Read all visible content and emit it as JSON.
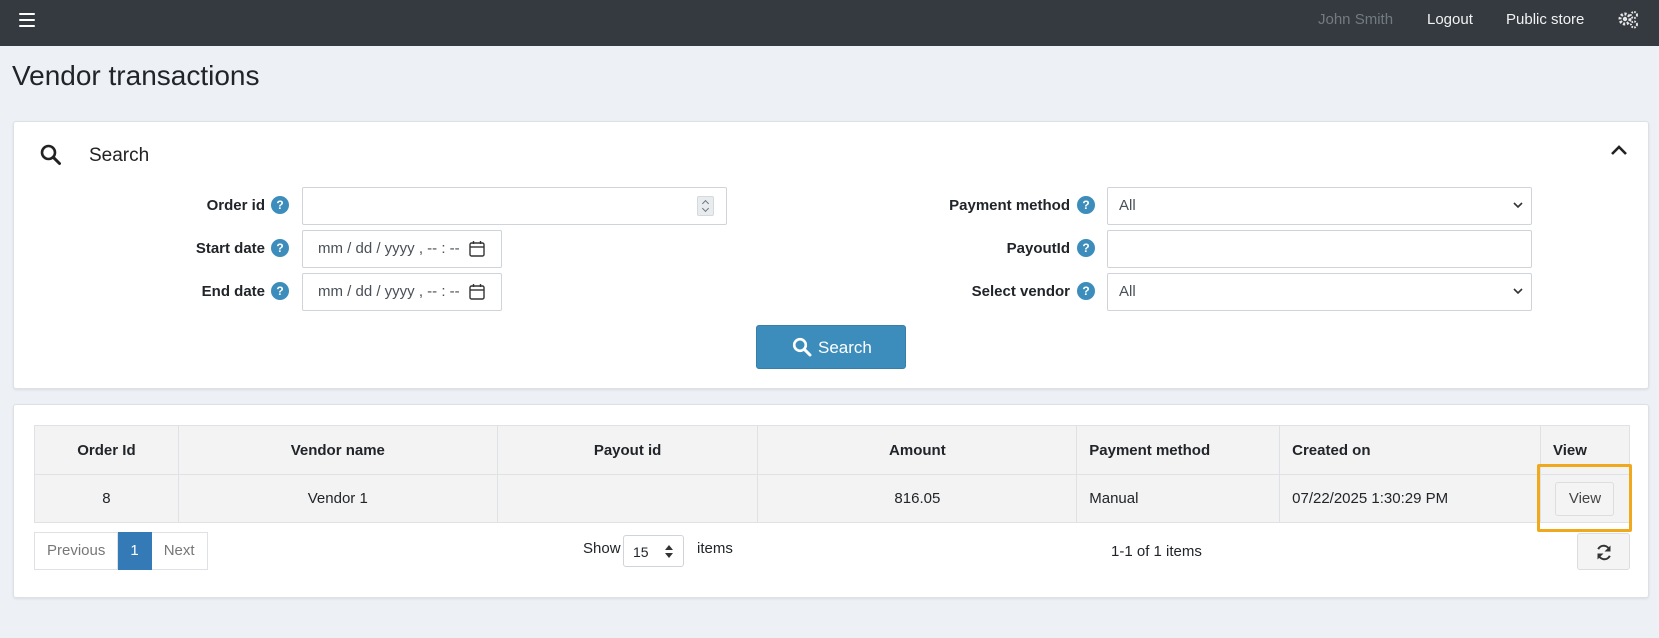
{
  "topbar": {
    "user_name": "John Smith",
    "logout_label": "Logout",
    "public_store_label": "Public store",
    "menu_icon": "hamburger-menu-icon",
    "settings_icon": "gears-icon"
  },
  "page_title": "Vendor transactions",
  "search_panel": {
    "title": "Search",
    "fields": {
      "order_id": {
        "label": "Order id",
        "value": ""
      },
      "start_date": {
        "label": "Start date",
        "placeholder": "mm / dd / yyyy ,  -- : --"
      },
      "end_date": {
        "label": "End date",
        "placeholder": "mm / dd / yyyy ,  -- : --"
      },
      "payment_method": {
        "label": "Payment method",
        "selected": "All"
      },
      "payout_id": {
        "label": "PayoutId",
        "value": ""
      },
      "select_vendor": {
        "label": "Select vendor",
        "selected": "All"
      }
    },
    "help_glyph": "?",
    "search_button_label": "Search"
  },
  "table": {
    "columns": [
      "Order Id",
      "Vendor name",
      "Payout id",
      "Amount",
      "Payment method",
      "Created on",
      "View"
    ],
    "rows": [
      {
        "order_id": "8",
        "vendor_name": "Vendor 1",
        "payout_id": "",
        "amount": "816.05",
        "payment_method": "Manual",
        "created_on": "07/22/2025 1:30:29 PM",
        "view_label": "View"
      }
    ]
  },
  "pager": {
    "previous_label": "Previous",
    "current_page": "1",
    "next_label": "Next",
    "show_label": "Show",
    "page_size": "15",
    "items_label": "items",
    "count_text": "1-1 of 1 items"
  },
  "colors": {
    "topbar_bg": "#343a40",
    "accent": "#3c8dbc",
    "pager_active": "#337ab7",
    "highlight": "#f0a91c"
  }
}
